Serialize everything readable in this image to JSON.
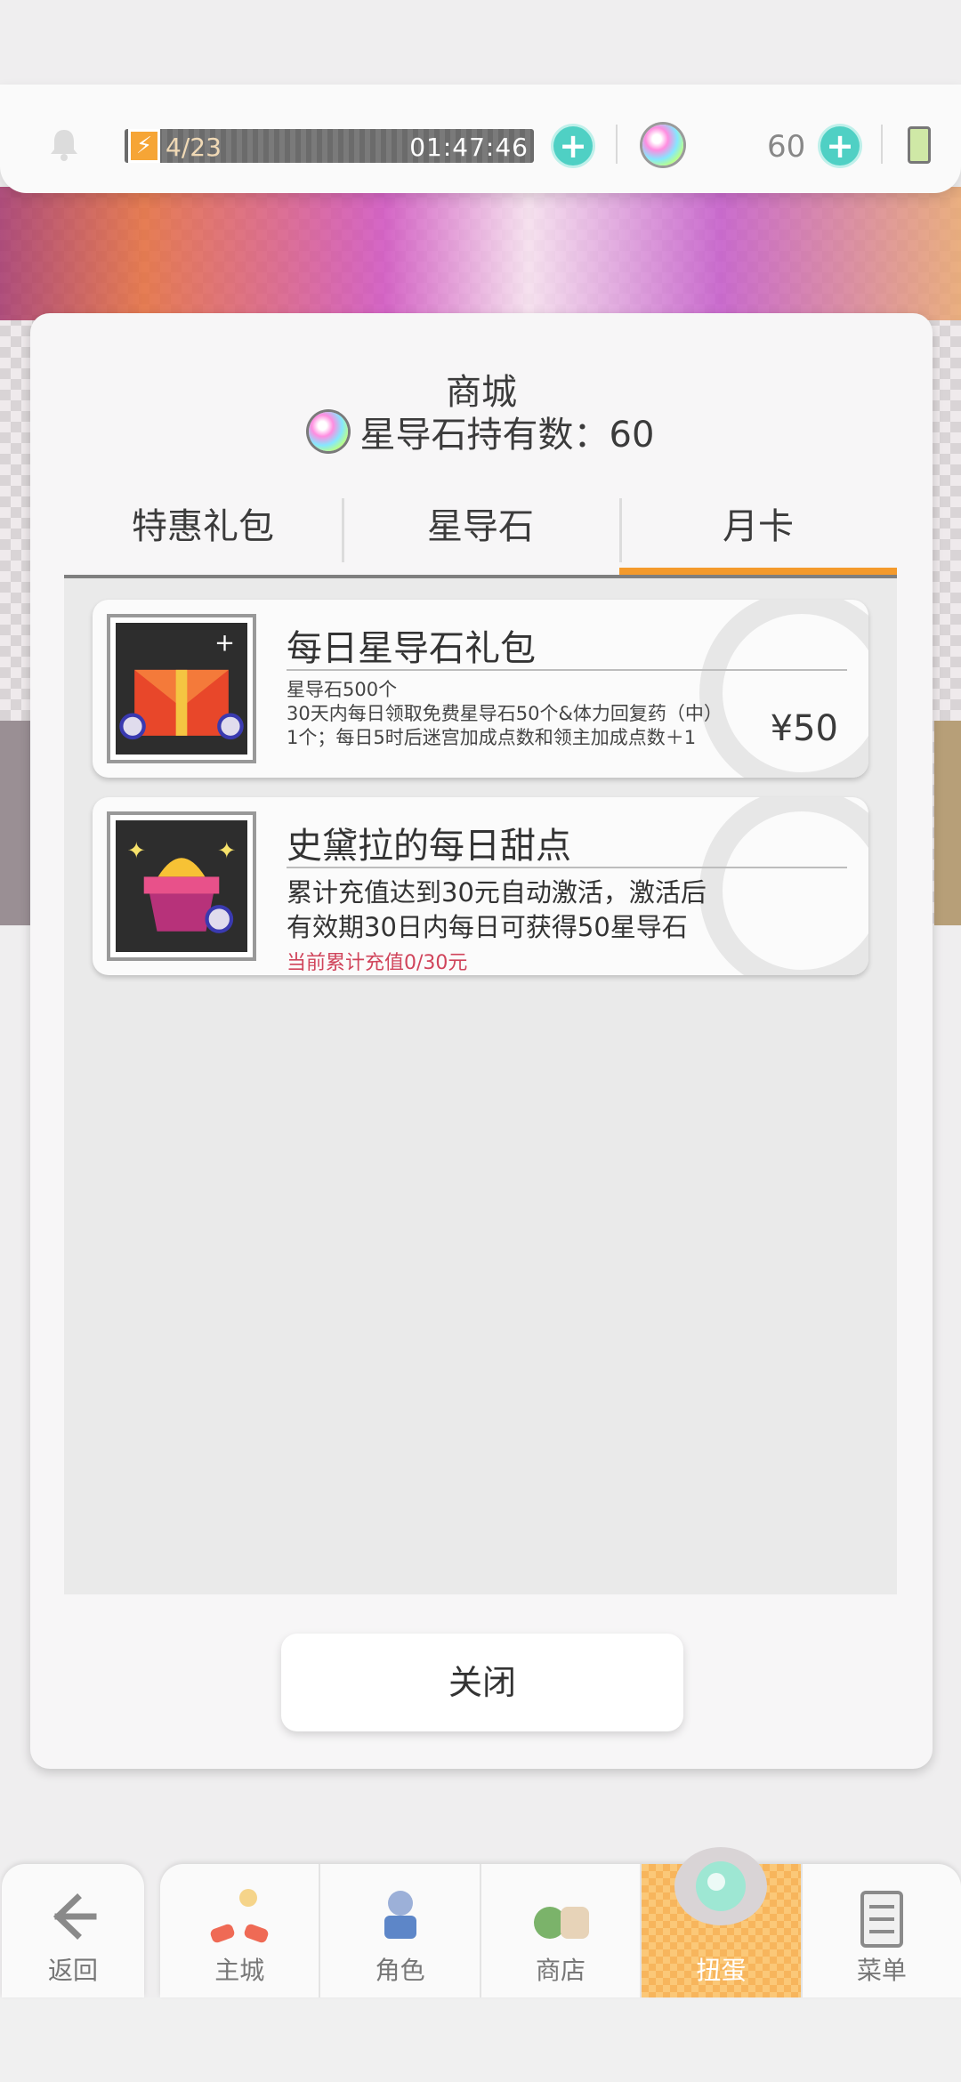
{
  "status_bar": {
    "stamina": "4/23",
    "timer": "01:47:46",
    "gem_count": "60"
  },
  "modal": {
    "title": "商城",
    "gem_label": "星导石持有数：60",
    "tabs": [
      {
        "label": "特惠礼包",
        "active": false
      },
      {
        "label": "星导石",
        "active": false
      },
      {
        "label": "月卡",
        "active": true
      }
    ],
    "items": [
      {
        "title": "每日星导石礼包",
        "desc_lines": [
          "星导石500个",
          "30天内每日领取免费星导石50个&体力回复药（中）",
          "1个；每日5时后迷宫加成点数和领主加成点数＋1"
        ],
        "price": "¥50"
      },
      {
        "title": "史黛拉的每日甜点",
        "desc_lines": [
          "累计充值达到30元自动激活，激活后",
          "有效期30日内每日可获得50星导石"
        ],
        "note": "当前累计充值0/30元"
      }
    ],
    "close_label": "关闭"
  },
  "bottom_nav": {
    "back_label": "返回",
    "items": [
      {
        "label": "主城",
        "icon": "town-icon"
      },
      {
        "label": "角色",
        "icon": "character-icon"
      },
      {
        "label": "商店",
        "icon": "shop-icon"
      },
      {
        "label": "扭蛋",
        "icon": "gacha-icon",
        "active": true
      },
      {
        "label": "菜单",
        "icon": "menu-icon"
      }
    ]
  },
  "colors": {
    "accent_orange": "#f49a2c",
    "note_red": "#d0445b",
    "plus_teal": "#4fd0c4"
  }
}
